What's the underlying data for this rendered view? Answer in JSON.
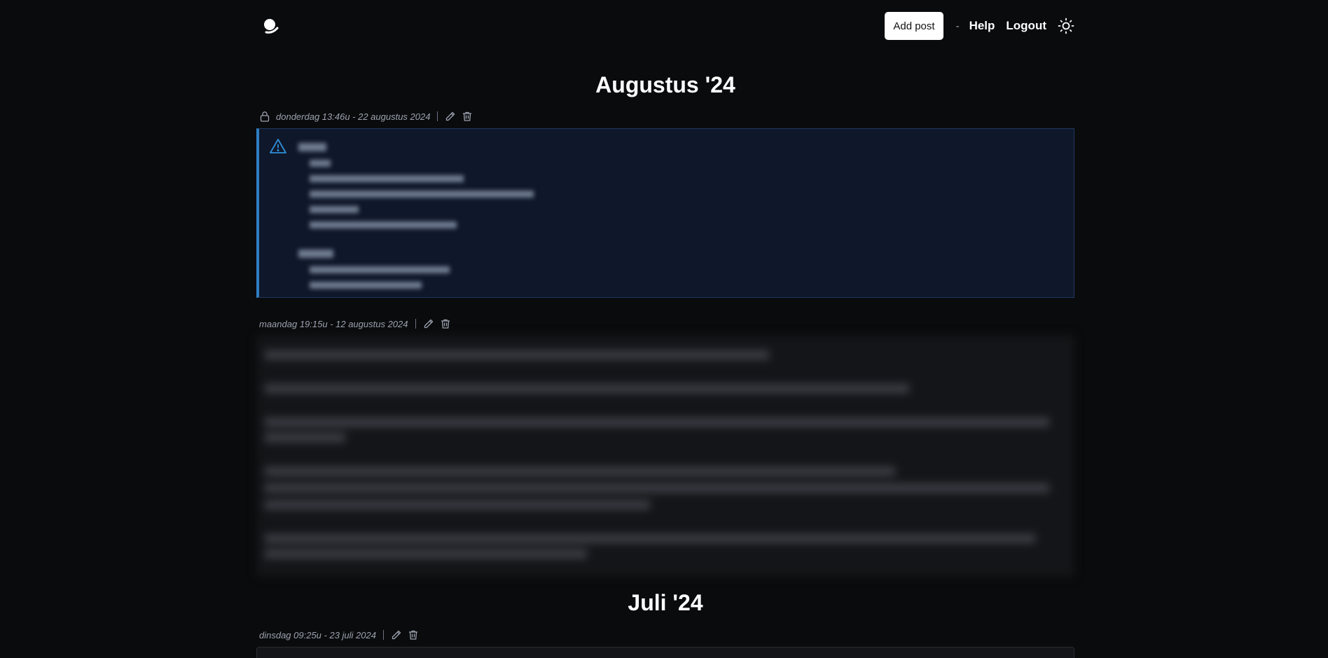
{
  "header": {
    "add_post": "Add post",
    "separator": "-",
    "help": "Help",
    "logout": "Logout"
  },
  "months": [
    {
      "title": "Augustus '24",
      "posts": [
        {
          "private": true,
          "meta": "donderdag 13:46u - 22 augustus 2024",
          "kind": "warning"
        },
        {
          "private": false,
          "meta": "maandag 19:15u - 12 augustus 2024",
          "kind": "text"
        }
      ]
    },
    {
      "title": "Juli '24",
      "posts": [
        {
          "private": false,
          "meta": "dinsdag 09:25u - 23 juli 2024",
          "kind": "text"
        }
      ]
    }
  ],
  "colors": {
    "background": "#0a0b0d",
    "callout_accent": "#2f7ec1",
    "callout_bg": "#0f172a",
    "post_bg": "#141518"
  }
}
